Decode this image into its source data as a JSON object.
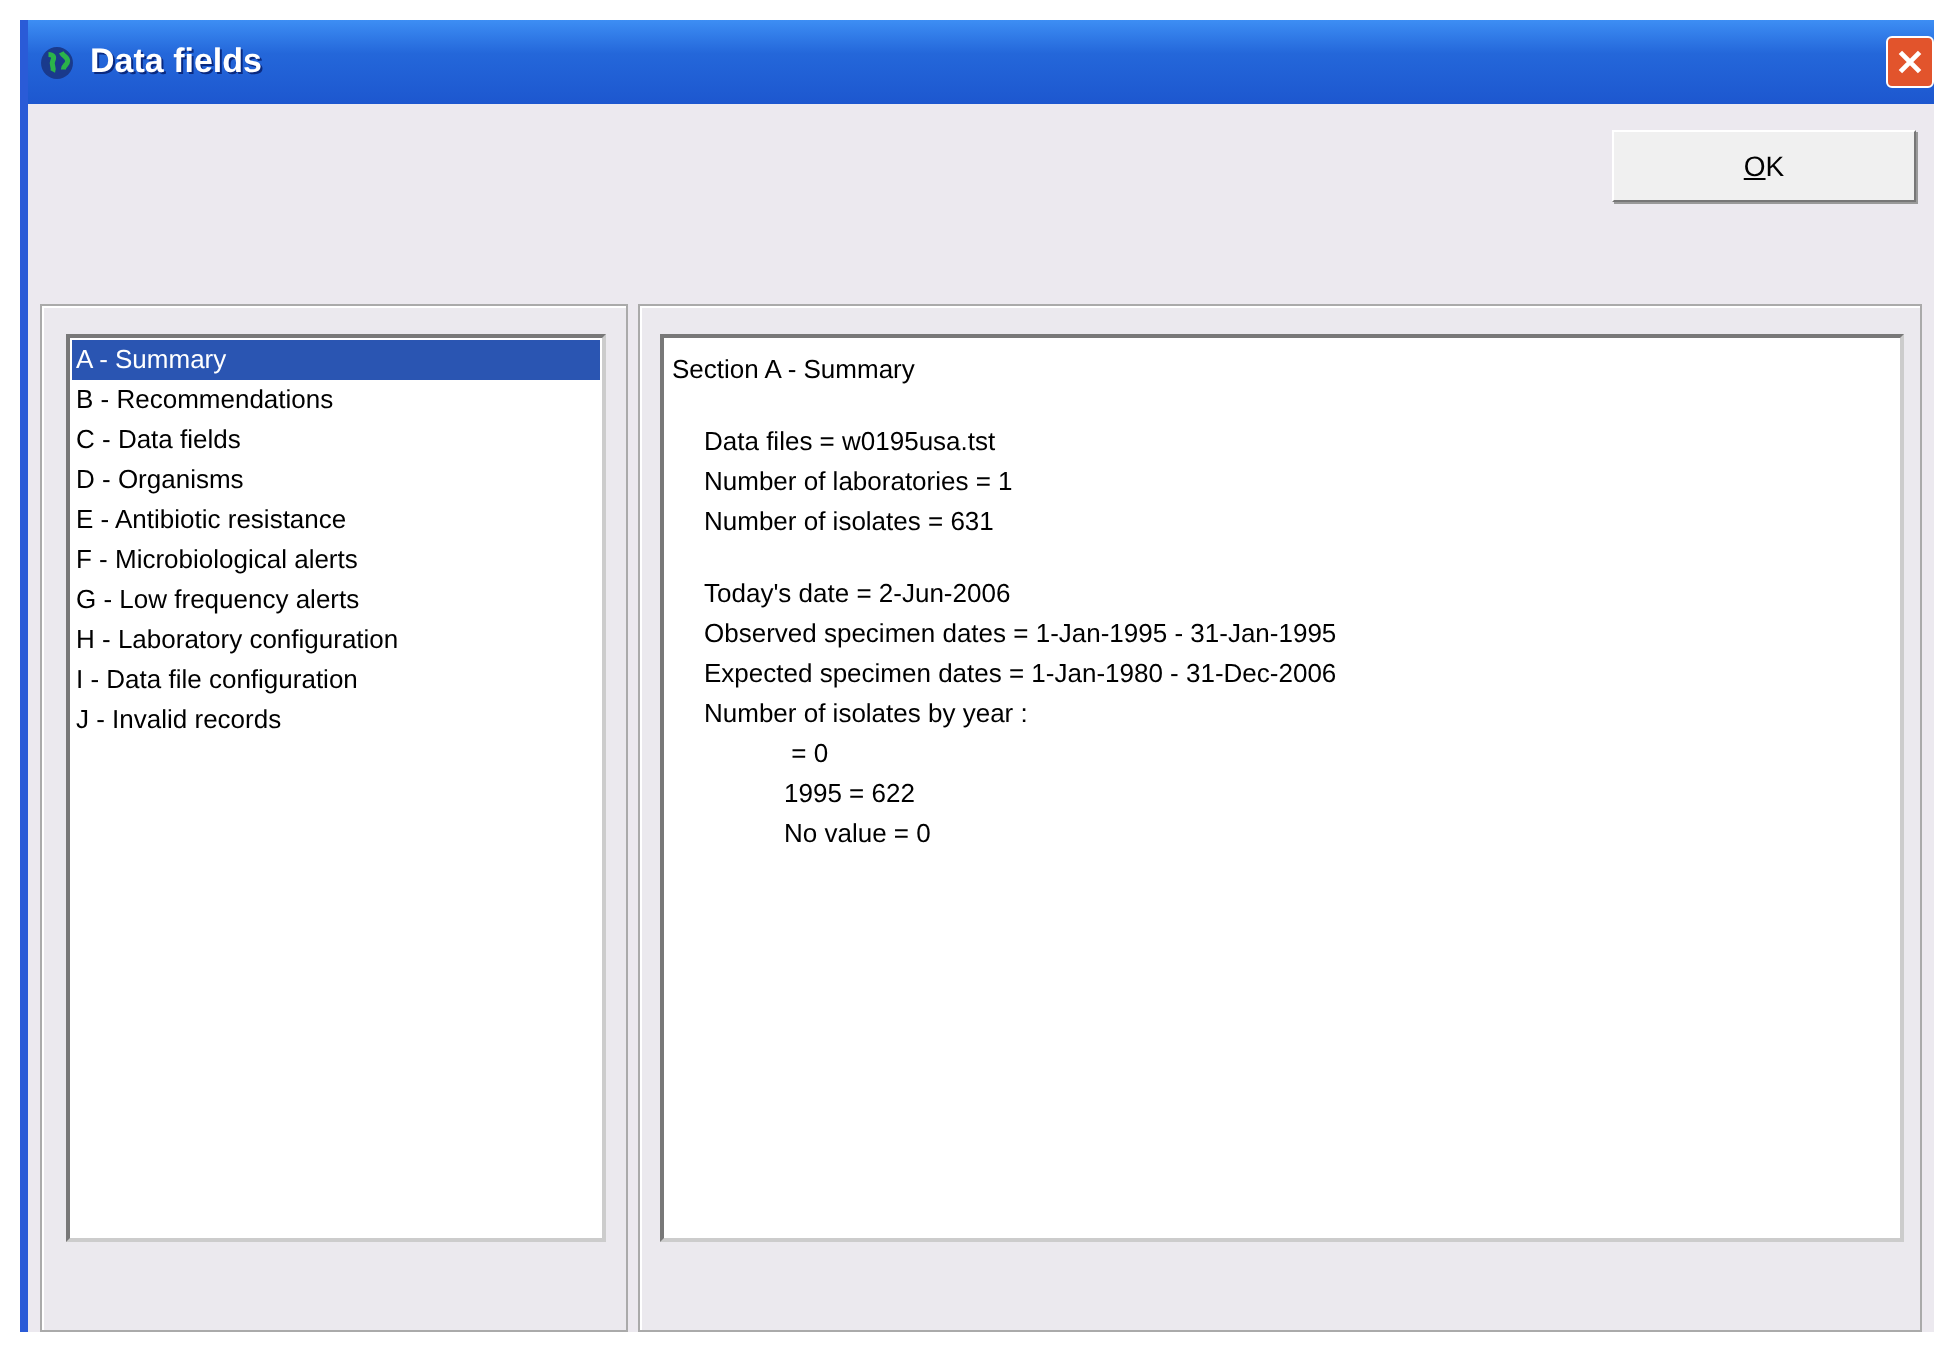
{
  "window": {
    "title": "Data fields"
  },
  "buttons": [
    {
      "label": "OK",
      "mnemonic": true
    }
  ],
  "sections": [
    {
      "label": "A - Summary",
      "selected": true
    },
    {
      "label": "B - Recommendations",
      "selected": false
    },
    {
      "label": "C - Data fields",
      "selected": false
    },
    {
      "label": "D - Organisms",
      "selected": false
    },
    {
      "label": "E - Antibiotic resistance",
      "selected": false
    },
    {
      "label": "F - Microbiological alerts",
      "selected": false
    },
    {
      "label": "G - Low frequency alerts",
      "selected": false
    },
    {
      "label": "H - Laboratory configuration",
      "selected": false
    },
    {
      "label": "I - Data file configuration",
      "selected": false
    },
    {
      "label": "J - Invalid records",
      "selected": false
    }
  ],
  "report": {
    "title": "Section A - Summary",
    "groups": [
      {
        "lines": [
          {
            "text": "Data files = w0195usa.tst"
          },
          {
            "text": "Number of laboratories = 1"
          },
          {
            "text": "Number of isolates = 631"
          }
        ]
      },
      {
        "lines": [
          {
            "text": "Today's date = 2-Jun-2006"
          },
          {
            "text": "Observed specimen dates = 1-Jan-1995 - 31-Jan-1995"
          },
          {
            "text": "Expected specimen dates = 1-Jan-1980 - 31-Dec-2006"
          },
          {
            "text": "Number of isolates by year :",
            "children": [
              {
                "text": " = 0"
              },
              {
                "text": "1995 = 622"
              },
              {
                "text": "No value = 0"
              }
            ]
          }
        ]
      }
    ]
  }
}
